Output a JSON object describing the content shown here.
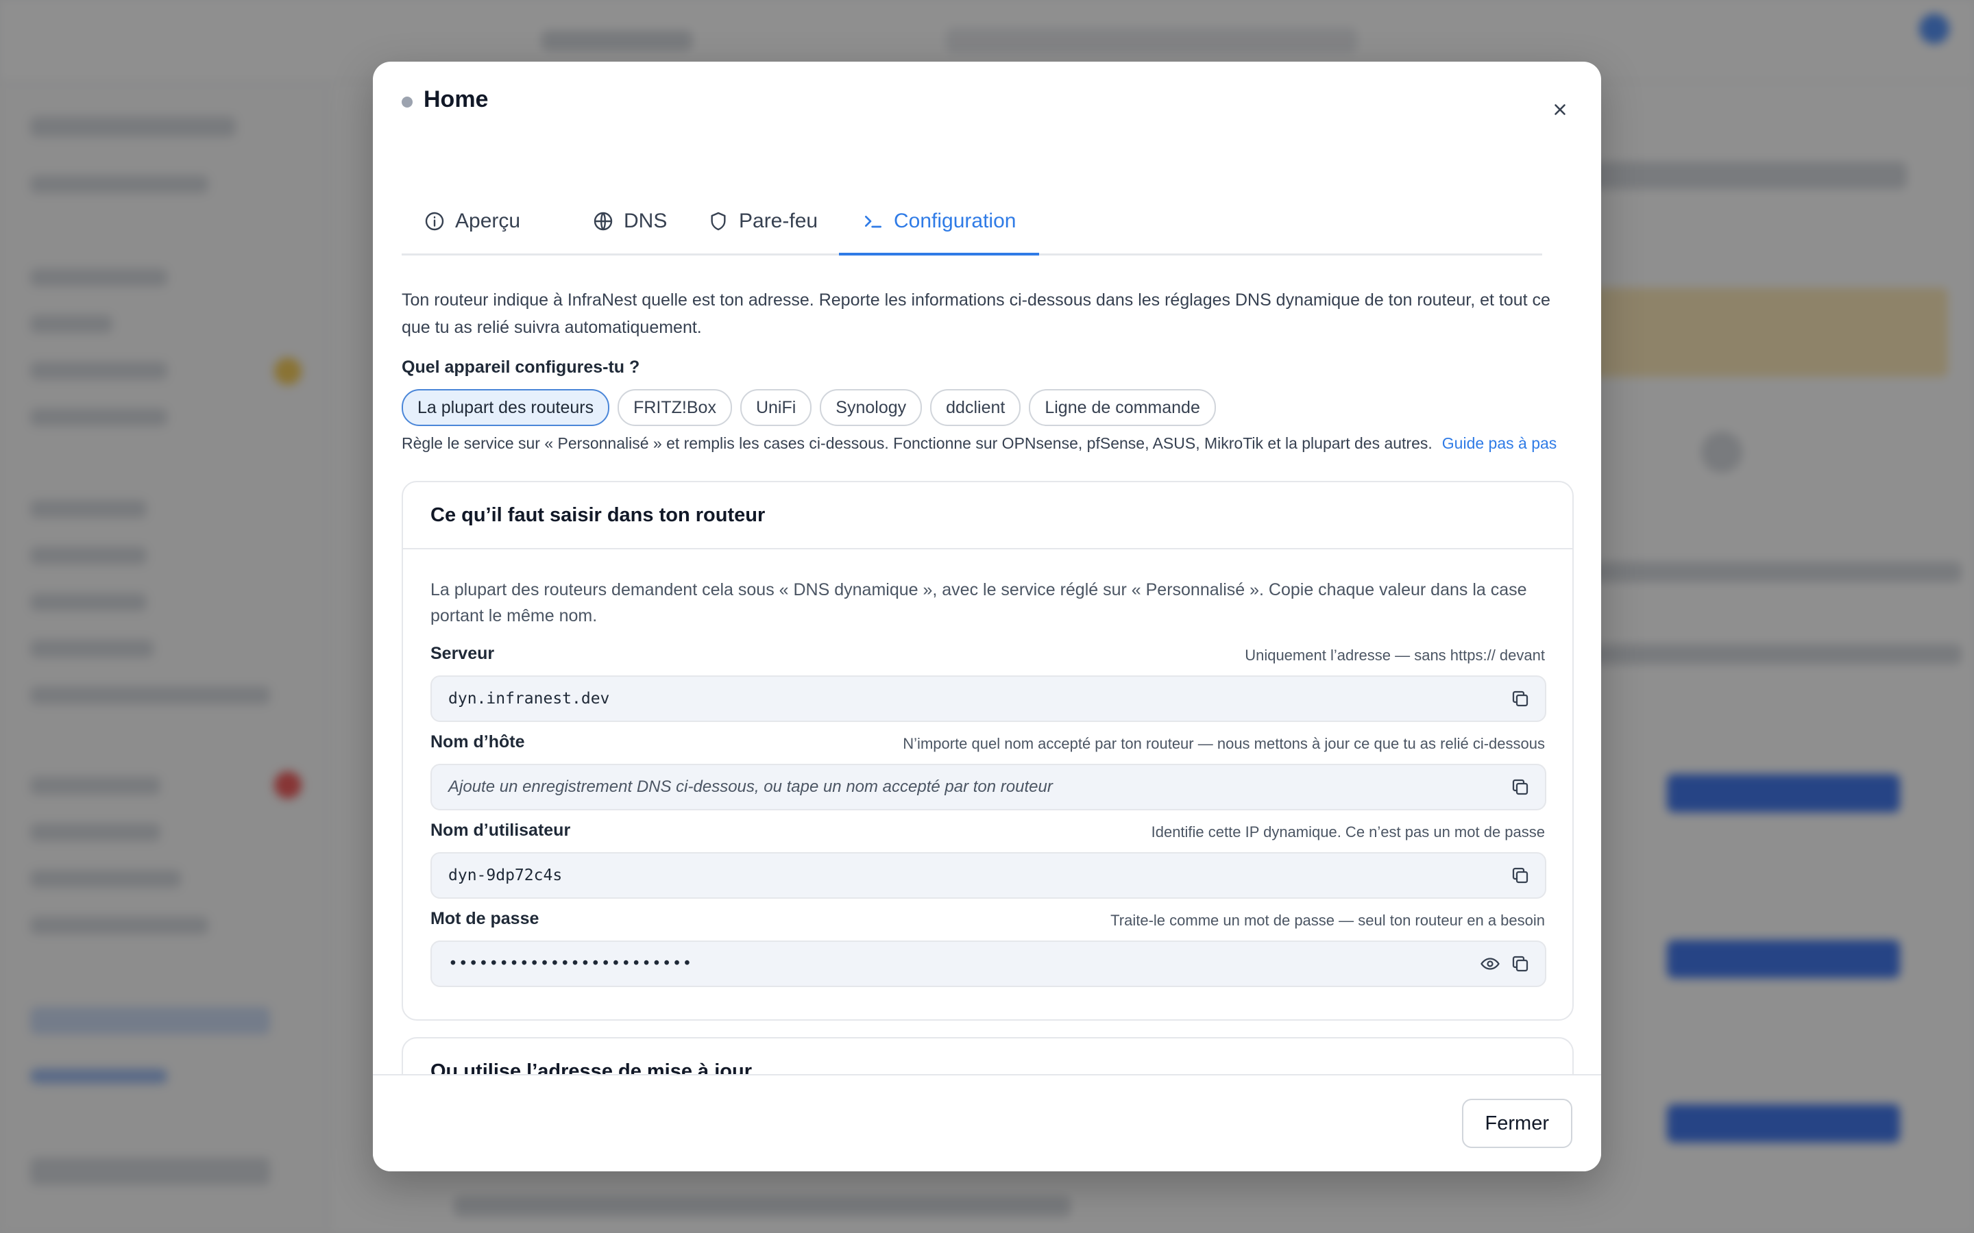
{
  "dialog": {
    "title": "Home",
    "tabs": [
      {
        "label": "Aperçu",
        "icon": "info-icon"
      },
      {
        "label": "DNS",
        "icon": "globe-icon"
      },
      {
        "label": "Pare-feu",
        "icon": "shield-icon"
      },
      {
        "label": "Configuration",
        "icon": "terminal-icon",
        "active": true
      }
    ],
    "intro": "Ton routeur indique à InfraNest quelle est ton adresse. Reporte les informations ci-dessous dans les réglages DNS dynamique de ton routeur, et tout ce que tu as relié suivra automatiquement.",
    "device_question": "Quel appareil configures-tu ?",
    "devices": [
      {
        "label": "La plupart des routeurs",
        "selected": true
      },
      {
        "label": "FRITZ!Box"
      },
      {
        "label": "UniFi"
      },
      {
        "label": "Synology"
      },
      {
        "label": "ddclient"
      },
      {
        "label": "Ligne de commande"
      }
    ],
    "device_hint": "Règle le service sur « Personnalisé » et remplis les cases ci-dessous. Fonctionne sur OPNsense, pfSense, ASUS, MikroTik et la plupart des autres.",
    "guide_link": "Guide pas à pas",
    "router_card": {
      "title": "Ce qu’il faut saisir dans ton routeur",
      "description": "La plupart des routeurs demandent cela sous « DNS dynamique », avec le service réglé sur « Personnalisé ». Copie chaque valeur dans la case portant le même nom.",
      "fields": [
        {
          "label": "Serveur",
          "hint": "Uniquement l’adresse — sans https:// devant",
          "value": "dyn.infranest.dev"
        },
        {
          "label": "Nom d’hôte",
          "hint": "N’importe quel nom accepté par ton routeur — nous mettons à jour ce que tu as relié ci-dessous",
          "placeholder": "Ajoute un enregistrement DNS ci-dessous, ou tape un nom accepté par ton routeur"
        },
        {
          "label": "Nom d’utilisateur",
          "hint": "Identifie cette IP dynamique. Ce n’est pas un mot de passe",
          "value": "dyn-9dp72c4s"
        },
        {
          "label": "Mot de passe",
          "hint": "Traite-le comme un mot de passe — seul ton routeur en a besoin",
          "value": "••••••••••••••••••••••••"
        }
      ]
    },
    "update_card": {
      "title": "Ou utilise l’adresse de mise à jour"
    },
    "close_label": "Fermer"
  },
  "colors": {
    "accent": "#2f7be6",
    "overlay": "rgba(40,40,40,0.52)",
    "field_bg": "#f1f4f9"
  }
}
